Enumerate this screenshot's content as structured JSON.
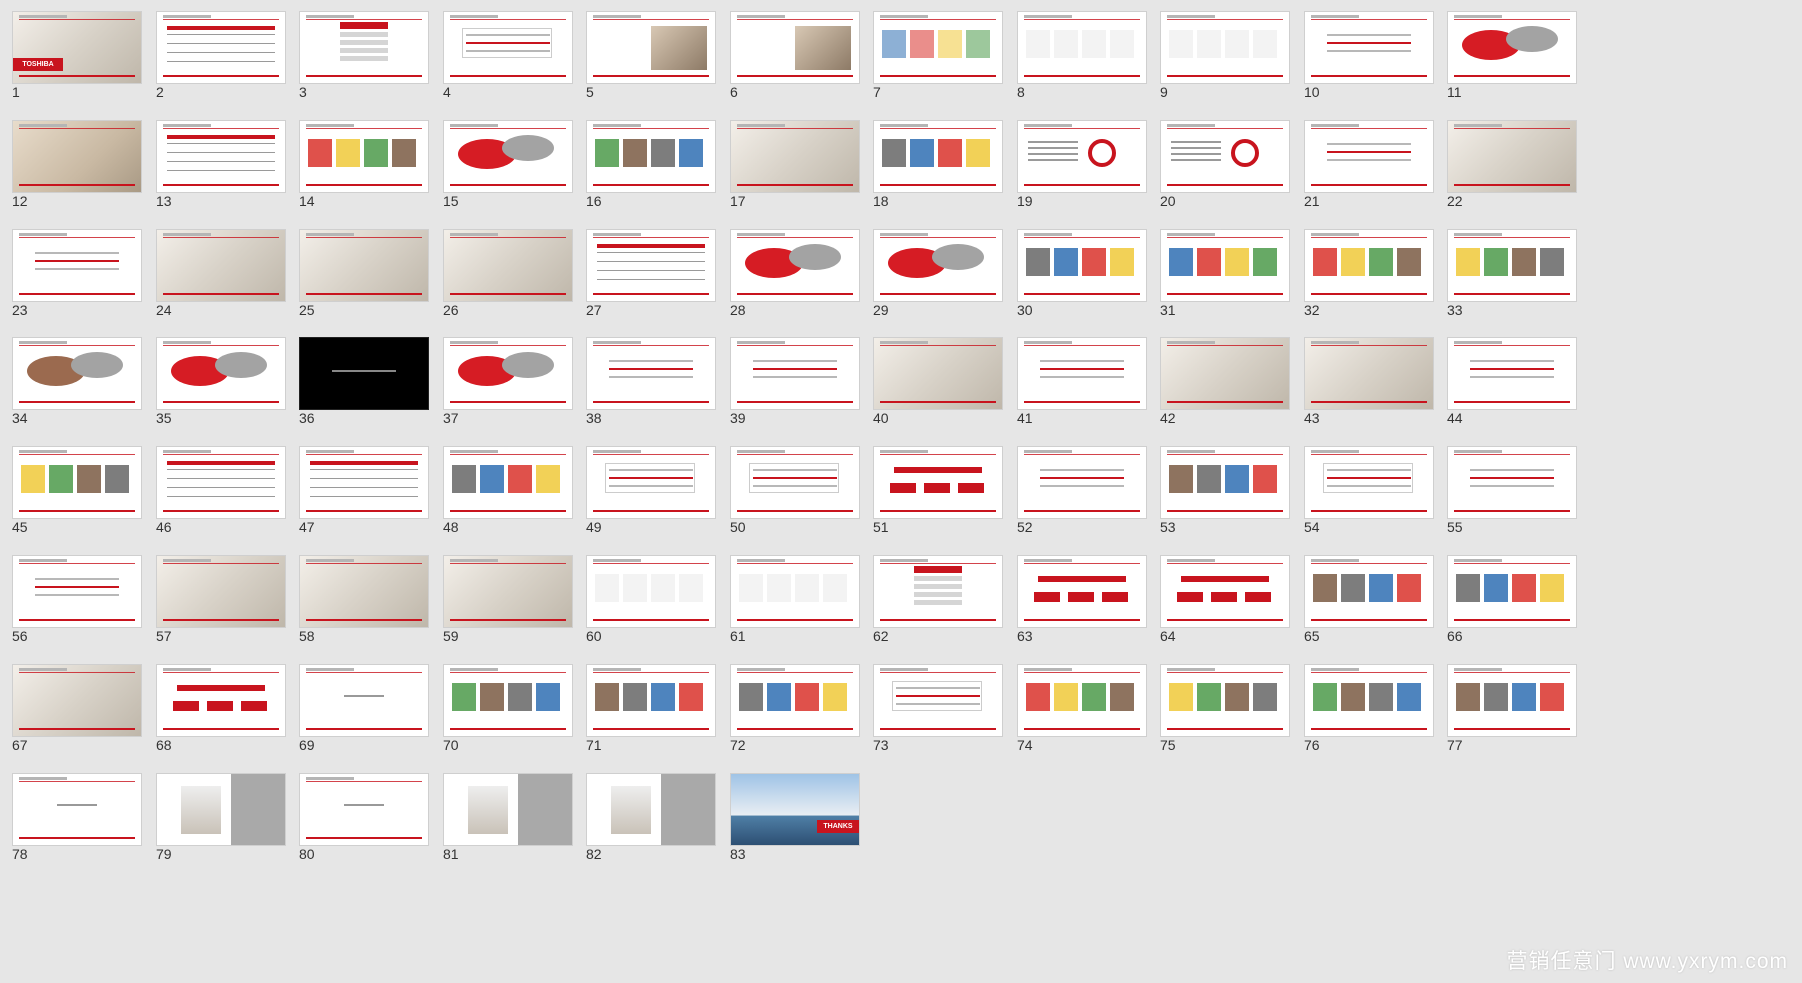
{
  "slides": [
    {
      "number": "1",
      "style": "photo",
      "logo": "TOSHIBA"
    },
    {
      "number": "2",
      "style": "table"
    },
    {
      "number": "3",
      "style": "house"
    },
    {
      "number": "4",
      "style": "box"
    },
    {
      "number": "5",
      "style": "photo-right"
    },
    {
      "number": "6",
      "style": "photo-right"
    },
    {
      "number": "7",
      "style": "icons"
    },
    {
      "number": "8",
      "style": "logos"
    },
    {
      "number": "9",
      "style": "logos"
    },
    {
      "number": "10",
      "style": "text"
    },
    {
      "number": "11",
      "style": "venn"
    },
    {
      "number": "12",
      "style": "beige"
    },
    {
      "number": "13",
      "style": "table"
    },
    {
      "number": "14",
      "style": "photos"
    },
    {
      "number": "15",
      "style": "venn"
    },
    {
      "number": "16",
      "style": "collage"
    },
    {
      "number": "17",
      "style": "photo"
    },
    {
      "number": "18",
      "style": "posters"
    },
    {
      "number": "19",
      "style": "chart"
    },
    {
      "number": "20",
      "style": "chart"
    },
    {
      "number": "21",
      "style": "text"
    },
    {
      "number": "22",
      "style": "photo"
    },
    {
      "number": "23",
      "style": "text"
    },
    {
      "number": "24",
      "style": "photo"
    },
    {
      "number": "25",
      "style": "photo"
    },
    {
      "number": "26",
      "style": "photo"
    },
    {
      "number": "27",
      "style": "table"
    },
    {
      "number": "28",
      "style": "venn"
    },
    {
      "number": "29",
      "style": "venn"
    },
    {
      "number": "30",
      "style": "photos"
    },
    {
      "number": "31",
      "style": "photos"
    },
    {
      "number": "32",
      "style": "collage"
    },
    {
      "number": "33",
      "style": "collage"
    },
    {
      "number": "34",
      "style": "venn-brown"
    },
    {
      "number": "35",
      "style": "venn"
    },
    {
      "number": "36",
      "style": "dark"
    },
    {
      "number": "37",
      "style": "venn"
    },
    {
      "number": "38",
      "style": "text"
    },
    {
      "number": "39",
      "style": "text"
    },
    {
      "number": "40",
      "style": "photo"
    },
    {
      "number": "41",
      "style": "text"
    },
    {
      "number": "42",
      "style": "photo"
    },
    {
      "number": "43",
      "style": "photo"
    },
    {
      "number": "44",
      "style": "text"
    },
    {
      "number": "45",
      "style": "photos"
    },
    {
      "number": "46",
      "style": "table"
    },
    {
      "number": "47",
      "style": "table"
    },
    {
      "number": "48",
      "style": "photos"
    },
    {
      "number": "49",
      "style": "box"
    },
    {
      "number": "50",
      "style": "box"
    },
    {
      "number": "51",
      "style": "diagram"
    },
    {
      "number": "52",
      "style": "text"
    },
    {
      "number": "53",
      "style": "collage"
    },
    {
      "number": "54",
      "style": "box"
    },
    {
      "number": "55",
      "style": "text"
    },
    {
      "number": "56",
      "style": "text"
    },
    {
      "number": "57",
      "style": "photo"
    },
    {
      "number": "58",
      "style": "photo"
    },
    {
      "number": "59",
      "style": "photo"
    },
    {
      "number": "60",
      "style": "logos"
    },
    {
      "number": "61",
      "style": "logos"
    },
    {
      "number": "62",
      "style": "house"
    },
    {
      "number": "63",
      "style": "diagram"
    },
    {
      "number": "64",
      "style": "diagram"
    },
    {
      "number": "65",
      "style": "photos"
    },
    {
      "number": "66",
      "style": "photos"
    },
    {
      "number": "67",
      "style": "photo"
    },
    {
      "number": "68",
      "style": "diagram"
    },
    {
      "number": "69",
      "style": "blank"
    },
    {
      "number": "70",
      "style": "photos"
    },
    {
      "number": "71",
      "style": "photos"
    },
    {
      "number": "72",
      "style": "photos"
    },
    {
      "number": "73",
      "style": "box"
    },
    {
      "number": "74",
      "style": "photos"
    },
    {
      "number": "75",
      "style": "photos"
    },
    {
      "number": "76",
      "style": "photos"
    },
    {
      "number": "77",
      "style": "photos"
    },
    {
      "number": "78",
      "style": "blank"
    },
    {
      "number": "79",
      "style": "gray"
    },
    {
      "number": "80",
      "style": "blank"
    },
    {
      "number": "81",
      "style": "gray"
    },
    {
      "number": "82",
      "style": "gray"
    },
    {
      "number": "83",
      "style": "sky",
      "badge": "THANKS"
    }
  ],
  "watermark": "营销任意门 www.yxrym.com",
  "colors": {
    "accent": "#c8141e",
    "background": "#e6e6e6"
  }
}
